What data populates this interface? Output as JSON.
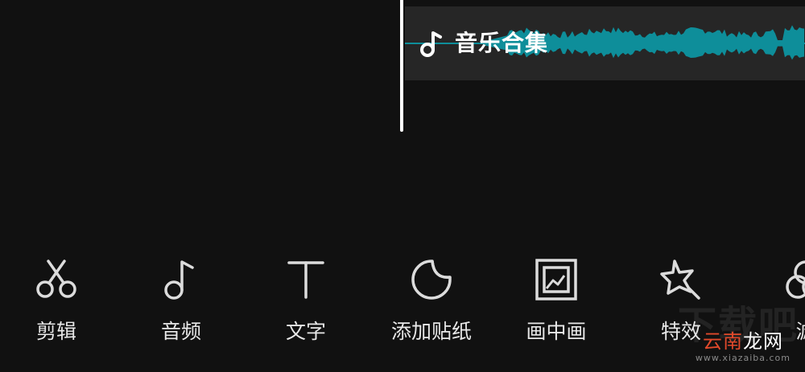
{
  "timeline": {
    "audio_track": {
      "title": "音乐合集",
      "icon": "music-note-icon",
      "waveform_color": "#0e8e9a"
    }
  },
  "toolbar": {
    "items": [
      {
        "label": "剪辑",
        "icon": "scissors-icon"
      },
      {
        "label": "音频",
        "icon": "music-note-icon"
      },
      {
        "label": "文字",
        "icon": "text-t-icon"
      },
      {
        "label": "添加贴纸",
        "icon": "sticker-icon"
      },
      {
        "label": "画中画",
        "icon": "picture-in-picture-icon"
      },
      {
        "label": "特效",
        "icon": "effects-star-icon"
      },
      {
        "label": "滤",
        "icon": "filter-icon"
      }
    ]
  },
  "watermark": {
    "text_a": "云南",
    "text_b": "龙网",
    "subtext": "www.xiazaiba.com",
    "background_text": "下载吧",
    "color_a": "#e0492b",
    "color_b": "#ffffff"
  }
}
